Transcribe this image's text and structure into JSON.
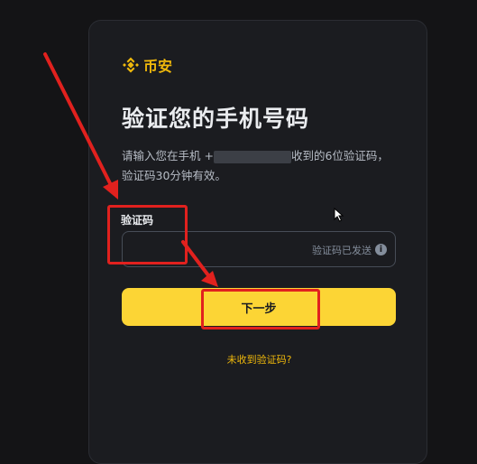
{
  "brand": {
    "logo_icon": "binance-diamond-icon",
    "name": "币安",
    "color": "#f0b90b"
  },
  "title": "验证您的手机号码",
  "description": {
    "before": "请输入您在手机 +",
    "after": "收到的6位验证码，验证码30分钟有效。"
  },
  "code_field": {
    "label": "验证码",
    "value": "",
    "status": "验证码已发送",
    "status_icon": "info-icon"
  },
  "next_button": {
    "label": "下一步",
    "color": "#fcd535"
  },
  "resend_link": {
    "label": "未收到验证码?"
  },
  "annotations": {
    "color": "#e1211e",
    "arrow_icon": "red-arrow-icon"
  }
}
